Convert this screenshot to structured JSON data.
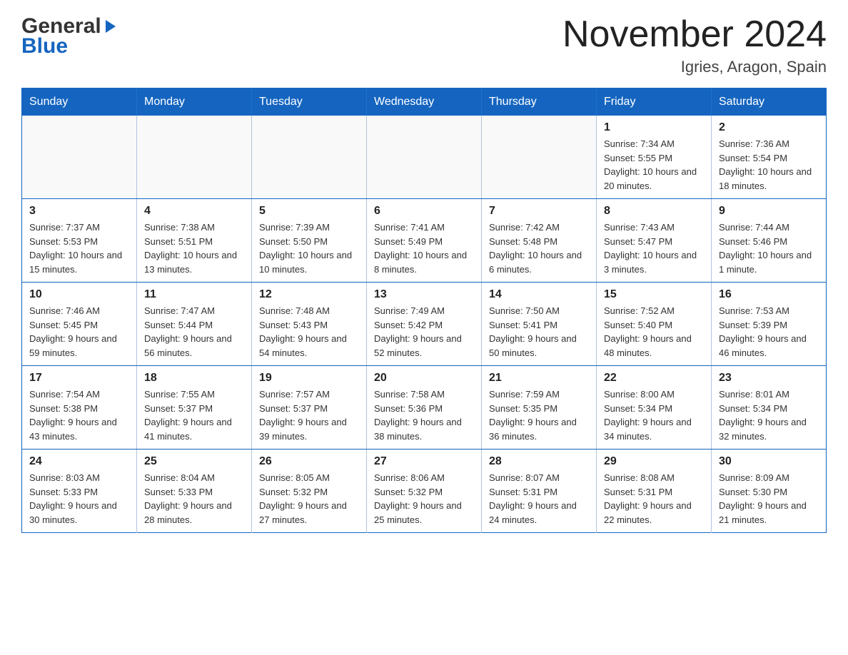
{
  "header": {
    "logo_general": "General",
    "logo_blue": "Blue",
    "title": "November 2024",
    "subtitle": "Igries, Aragon, Spain"
  },
  "days_of_week": [
    "Sunday",
    "Monday",
    "Tuesday",
    "Wednesday",
    "Thursday",
    "Friday",
    "Saturday"
  ],
  "weeks": [
    [
      {
        "day": "",
        "info": ""
      },
      {
        "day": "",
        "info": ""
      },
      {
        "day": "",
        "info": ""
      },
      {
        "day": "",
        "info": ""
      },
      {
        "day": "",
        "info": ""
      },
      {
        "day": "1",
        "info": "Sunrise: 7:34 AM\nSunset: 5:55 PM\nDaylight: 10 hours and 20 minutes."
      },
      {
        "day": "2",
        "info": "Sunrise: 7:36 AM\nSunset: 5:54 PM\nDaylight: 10 hours and 18 minutes."
      }
    ],
    [
      {
        "day": "3",
        "info": "Sunrise: 7:37 AM\nSunset: 5:53 PM\nDaylight: 10 hours and 15 minutes."
      },
      {
        "day": "4",
        "info": "Sunrise: 7:38 AM\nSunset: 5:51 PM\nDaylight: 10 hours and 13 minutes."
      },
      {
        "day": "5",
        "info": "Sunrise: 7:39 AM\nSunset: 5:50 PM\nDaylight: 10 hours and 10 minutes."
      },
      {
        "day": "6",
        "info": "Sunrise: 7:41 AM\nSunset: 5:49 PM\nDaylight: 10 hours and 8 minutes."
      },
      {
        "day": "7",
        "info": "Sunrise: 7:42 AM\nSunset: 5:48 PM\nDaylight: 10 hours and 6 minutes."
      },
      {
        "day": "8",
        "info": "Sunrise: 7:43 AM\nSunset: 5:47 PM\nDaylight: 10 hours and 3 minutes."
      },
      {
        "day": "9",
        "info": "Sunrise: 7:44 AM\nSunset: 5:46 PM\nDaylight: 10 hours and 1 minute."
      }
    ],
    [
      {
        "day": "10",
        "info": "Sunrise: 7:46 AM\nSunset: 5:45 PM\nDaylight: 9 hours and 59 minutes."
      },
      {
        "day": "11",
        "info": "Sunrise: 7:47 AM\nSunset: 5:44 PM\nDaylight: 9 hours and 56 minutes."
      },
      {
        "day": "12",
        "info": "Sunrise: 7:48 AM\nSunset: 5:43 PM\nDaylight: 9 hours and 54 minutes."
      },
      {
        "day": "13",
        "info": "Sunrise: 7:49 AM\nSunset: 5:42 PM\nDaylight: 9 hours and 52 minutes."
      },
      {
        "day": "14",
        "info": "Sunrise: 7:50 AM\nSunset: 5:41 PM\nDaylight: 9 hours and 50 minutes."
      },
      {
        "day": "15",
        "info": "Sunrise: 7:52 AM\nSunset: 5:40 PM\nDaylight: 9 hours and 48 minutes."
      },
      {
        "day": "16",
        "info": "Sunrise: 7:53 AM\nSunset: 5:39 PM\nDaylight: 9 hours and 46 minutes."
      }
    ],
    [
      {
        "day": "17",
        "info": "Sunrise: 7:54 AM\nSunset: 5:38 PM\nDaylight: 9 hours and 43 minutes."
      },
      {
        "day": "18",
        "info": "Sunrise: 7:55 AM\nSunset: 5:37 PM\nDaylight: 9 hours and 41 minutes."
      },
      {
        "day": "19",
        "info": "Sunrise: 7:57 AM\nSunset: 5:37 PM\nDaylight: 9 hours and 39 minutes."
      },
      {
        "day": "20",
        "info": "Sunrise: 7:58 AM\nSunset: 5:36 PM\nDaylight: 9 hours and 38 minutes."
      },
      {
        "day": "21",
        "info": "Sunrise: 7:59 AM\nSunset: 5:35 PM\nDaylight: 9 hours and 36 minutes."
      },
      {
        "day": "22",
        "info": "Sunrise: 8:00 AM\nSunset: 5:34 PM\nDaylight: 9 hours and 34 minutes."
      },
      {
        "day": "23",
        "info": "Sunrise: 8:01 AM\nSunset: 5:34 PM\nDaylight: 9 hours and 32 minutes."
      }
    ],
    [
      {
        "day": "24",
        "info": "Sunrise: 8:03 AM\nSunset: 5:33 PM\nDaylight: 9 hours and 30 minutes."
      },
      {
        "day": "25",
        "info": "Sunrise: 8:04 AM\nSunset: 5:33 PM\nDaylight: 9 hours and 28 minutes."
      },
      {
        "day": "26",
        "info": "Sunrise: 8:05 AM\nSunset: 5:32 PM\nDaylight: 9 hours and 27 minutes."
      },
      {
        "day": "27",
        "info": "Sunrise: 8:06 AM\nSunset: 5:32 PM\nDaylight: 9 hours and 25 minutes."
      },
      {
        "day": "28",
        "info": "Sunrise: 8:07 AM\nSunset: 5:31 PM\nDaylight: 9 hours and 24 minutes."
      },
      {
        "day": "29",
        "info": "Sunrise: 8:08 AM\nSunset: 5:31 PM\nDaylight: 9 hours and 22 minutes."
      },
      {
        "day": "30",
        "info": "Sunrise: 8:09 AM\nSunset: 5:30 PM\nDaylight: 9 hours and 21 minutes."
      }
    ]
  ]
}
